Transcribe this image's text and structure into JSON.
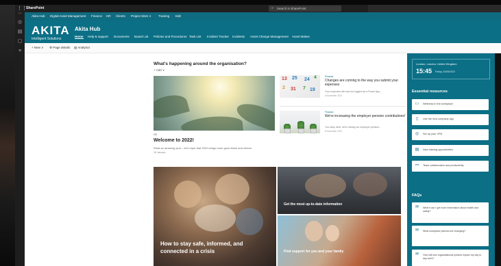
{
  "suite": {
    "app_name": "SharePoint",
    "search_placeholder": "Search in SharePoint"
  },
  "hub_nav": [
    "Akita Hub",
    "Digital Asset Management",
    "Finance",
    "HR",
    "Clients",
    "Project Sites ∨",
    "Training",
    "Edit"
  ],
  "header": {
    "logo_main": "AKITA",
    "logo_sub": "Intelligent Solutions",
    "site_title": "Akita Hub",
    "nav": [
      "Home",
      "Help & support",
      "Documents",
      "Board List",
      "Policies and Procedures",
      "Task List",
      "Incident Tracker",
      "Incidents",
      "Asset Change Management",
      "Asset Makes"
    ],
    "active_nav": "Home"
  },
  "command_bar": {
    "new": "+ New ∨",
    "page_details": "Page details",
    "analytics": "Analytics"
  },
  "news": {
    "title": "What's happening around the organisation?",
    "add": "+ Add ∨",
    "hero": {
      "tag": "HR",
      "title": "Welcome to 2022!",
      "desc": "What an amazing year – let's hope that 2022 brings more good times and cheers",
      "date": "18 January"
    },
    "items": [
      {
        "tag": "Finance",
        "title": "Changes are coming to the way you submit your expenses",
        "desc": "Your expenses will soon be logged via a Power App...",
        "date": "8 November 2021",
        "thumb_numbers": [
          "13",
          "25",
          "24",
          "4",
          "2",
          "31",
          "7",
          "19"
        ]
      },
      {
        "tag": "Finance",
        "title": "We're increasing the employer pension contributions!",
        "desc": "You lucky devil, we're raising our employer pension...",
        "date": "8 November 2021"
      }
    ]
  },
  "tiles": {
    "big": "How to stay safe, informed, and connected in a crisis",
    "top_right": "Get the most up-to-date information",
    "bottom_right": "Find support for you and your family"
  },
  "weather": {
    "location": "London, London, United Kingdom",
    "time": "15:45",
    "date": "Friday, 20/05/2022"
  },
  "essential": {
    "title": "Essential resources",
    "items": [
      {
        "icon": "clipboard-icon",
        "label": "Wellness in the workplace"
      },
      {
        "icon": "phone-icon",
        "label": "Use the new company app"
      },
      {
        "icon": "globe-icon",
        "label": "Set up your VPN"
      },
      {
        "icon": "training-icon",
        "label": "New training opportunities"
      },
      {
        "icon": "collab-icon",
        "label": "Team collaboration and productivity"
      }
    ]
  },
  "faq": {
    "title": "FAQs",
    "items": [
      "Where can I get more information about health and safety?",
      "What workplace policies are changing?",
      "How will new organisational policies impact my day to day work?"
    ]
  },
  "colors": {
    "brand": "#0b6f86",
    "hub_nav": "#0f6b80",
    "suite": "#1f1f1f"
  }
}
